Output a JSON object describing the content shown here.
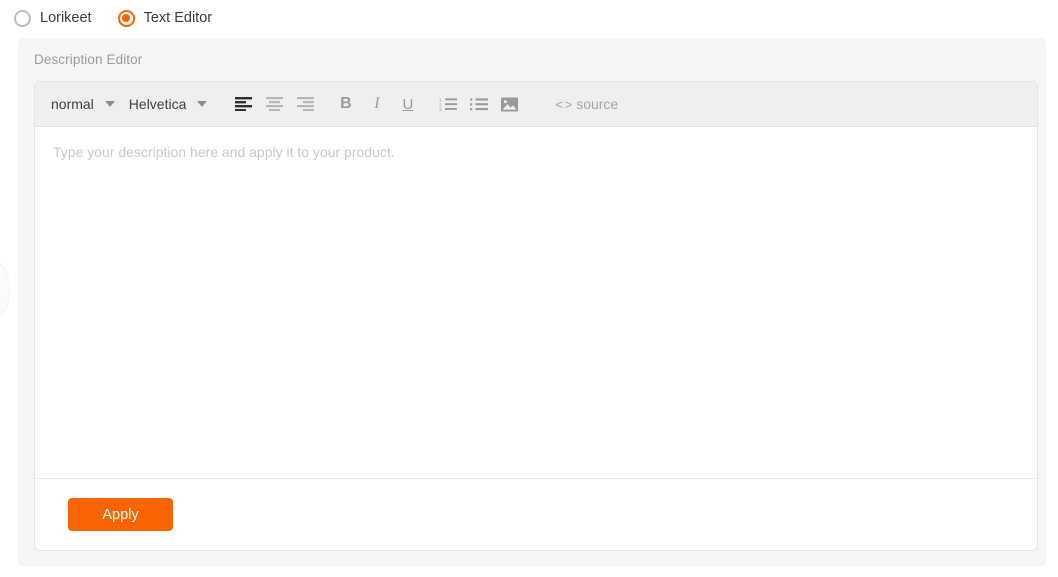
{
  "mode_selector": {
    "options": [
      {
        "label": "Lorikeet",
        "selected": false,
        "icon": "radio-unselected-icon"
      },
      {
        "label": "Text Editor",
        "selected": true,
        "icon": "radio-selected-icon"
      }
    ]
  },
  "panel": {
    "title": "Description Editor"
  },
  "toolbar": {
    "block_format": {
      "value": "normal",
      "caret_icon": "chevron-down-icon"
    },
    "font_family": {
      "value": "Helvetica",
      "caret_icon": "chevron-down-icon"
    },
    "buttons": [
      {
        "name": "align-left-icon",
        "label": "align left",
        "active": true
      },
      {
        "name": "align-center-icon",
        "label": "align center",
        "active": false
      },
      {
        "name": "align-right-icon",
        "label": "align right",
        "active": false
      },
      {
        "name": "bold-icon",
        "label": "B",
        "active": false
      },
      {
        "name": "italic-icon",
        "label": "I",
        "active": false
      },
      {
        "name": "underline-icon",
        "label": "U",
        "active": false
      },
      {
        "name": "ordered-list-icon",
        "label": "ordered list",
        "active": false
      },
      {
        "name": "bullet-list-icon",
        "label": "bullet list",
        "active": false
      },
      {
        "name": "image-icon",
        "label": "insert image",
        "active": false
      }
    ],
    "source": {
      "chevrons": "< >",
      "label": "source"
    }
  },
  "editor_body": {
    "value": "",
    "placeholder": "Type your description here and apply it to your product."
  },
  "footer": {
    "apply_label": "Apply"
  },
  "colors": {
    "accent": "#fa6400",
    "panel_bg": "#f5f5f6",
    "toolbar_bg": "#efefef",
    "border": "#e3e3e6",
    "muted_text": "#9b9b9e",
    "icon_inactive": "#9a9a9a",
    "icon_active": "#2f2f2f",
    "placeholder_text": "#c9c9cc"
  }
}
